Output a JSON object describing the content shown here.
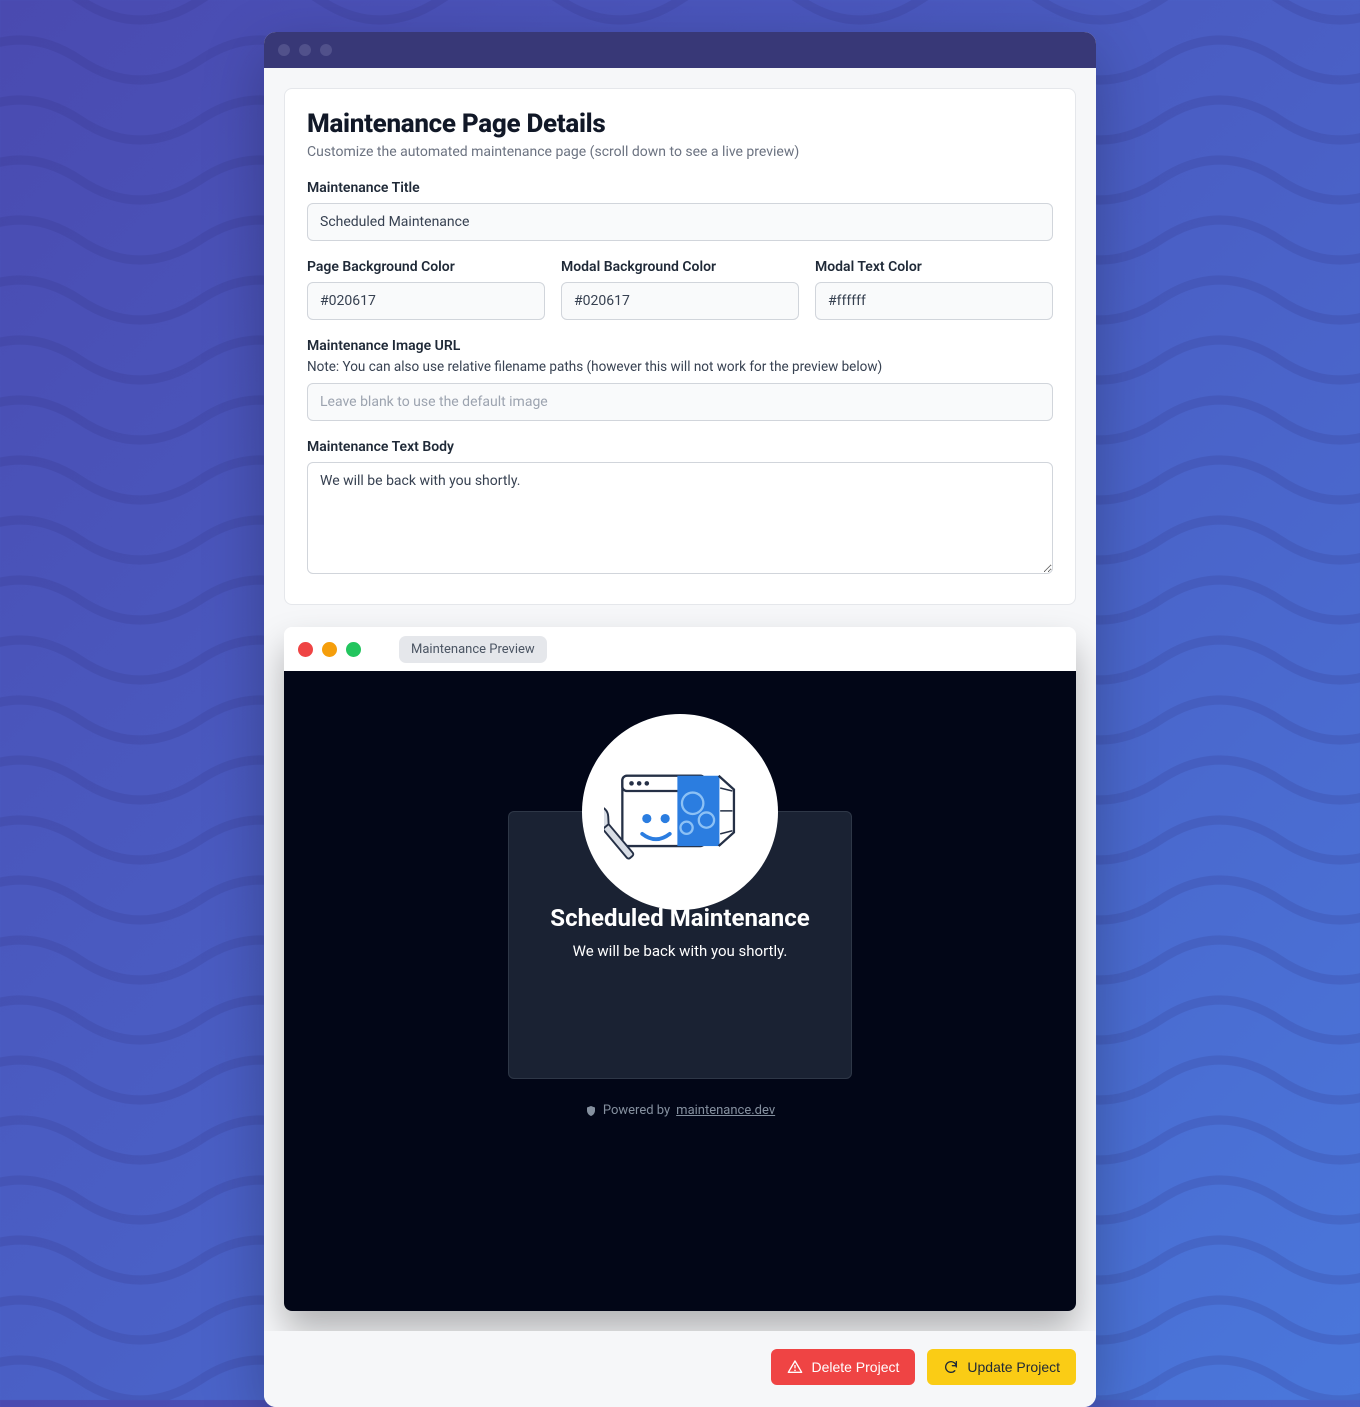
{
  "header": {
    "title": "Maintenance Page Details",
    "subtitle": "Customize the automated maintenance page (scroll down to see a live preview)"
  },
  "form": {
    "maintenance_title": {
      "label": "Maintenance Title",
      "value": "Scheduled Maintenance"
    },
    "page_bg": {
      "label": "Page Background Color",
      "value": "#020617"
    },
    "modal_bg": {
      "label": "Modal Background Color",
      "value": "#020617"
    },
    "modal_text": {
      "label": "Modal Text Color",
      "value": "#ffffff"
    },
    "image_url": {
      "label": "Maintenance Image URL",
      "note": "Note: You can also use relative filename paths (however this will not work for the preview below)",
      "placeholder": "Leave blank to use the default image",
      "value": ""
    },
    "text_body": {
      "label": "Maintenance Text Body",
      "value": "We will be back with you shortly."
    }
  },
  "preview": {
    "tab_label": "Maintenance Preview",
    "modal_title": "Scheduled Maintenance",
    "modal_body": "We will be back with you shortly.",
    "powered_prefix": "Powered by ",
    "powered_link": "maintenance.dev"
  },
  "actions": {
    "delete": "Delete Project",
    "update": "Update Project"
  },
  "colors": {
    "accent_danger": "#ef4444",
    "accent_warn": "#facc15",
    "preview_bg": "#020617"
  }
}
